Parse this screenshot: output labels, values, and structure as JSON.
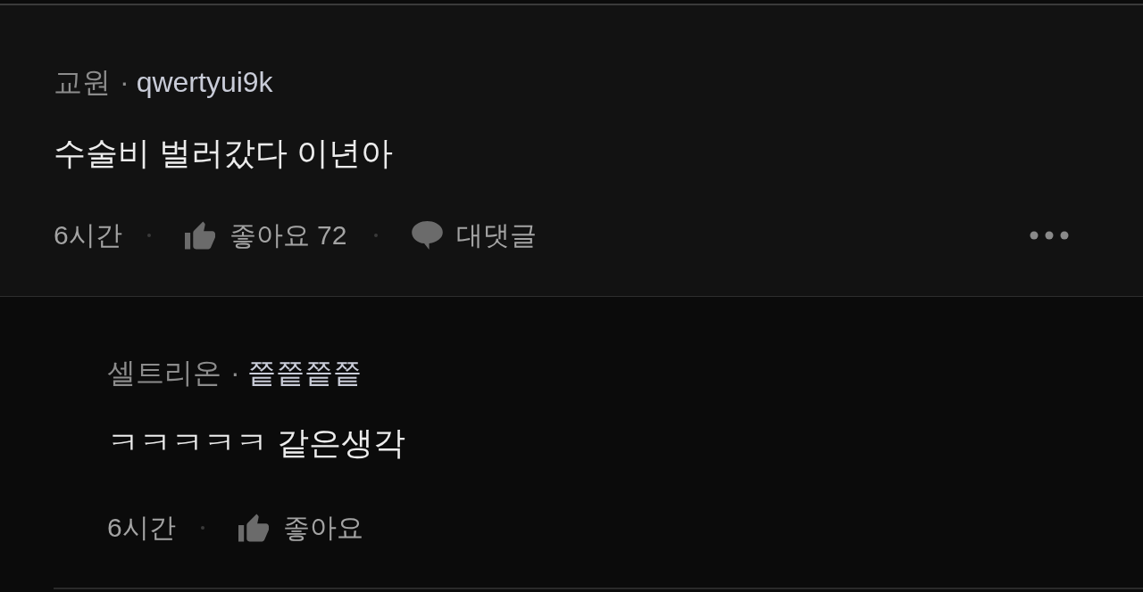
{
  "comments": [
    {
      "author_tag": "교원",
      "separator": "·",
      "author": "qwertyui9k",
      "text": "수술비 벌러갔다 이년아",
      "time": "6시간",
      "like_label": "좋아요",
      "like_count": "72",
      "reply_label": "대댓글",
      "replies": [
        {
          "author_tag": "셀트리온",
          "separator": "·",
          "author": "쯭쯭쯭쯭",
          "text": "ㅋㅋㅋㅋㅋ 같은생각",
          "time": "6시간",
          "like_label": "좋아요"
        }
      ]
    }
  ]
}
